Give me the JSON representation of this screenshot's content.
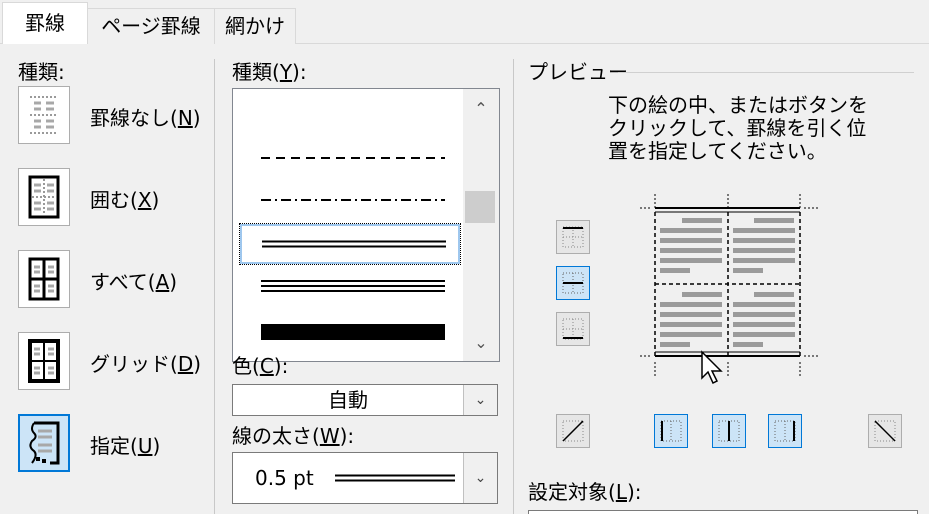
{
  "tabs": [
    {
      "label": "罫線",
      "active": true
    },
    {
      "label": "ページ罫線",
      "active": false
    },
    {
      "label": "網かけ",
      "active": false
    }
  ],
  "setting": {
    "heading": "種類:",
    "options": [
      {
        "label_text": "罫線なし(",
        "key": "N",
        "label_end": ")",
        "icon": "no-border-icon",
        "selected": false
      },
      {
        "label_text": "囲む(",
        "key": "X",
        "label_end": ")",
        "icon": "box-border-icon",
        "selected": false
      },
      {
        "label_text": "すべて(",
        "key": "A",
        "label_end": ")",
        "icon": "all-borders-icon",
        "selected": false
      },
      {
        "label_text": "グリッド(",
        "key": "D",
        "label_end": ")",
        "icon": "grid-border-icon",
        "selected": false
      },
      {
        "label_text": "指定(",
        "key": "U",
        "label_end": ")",
        "icon": "custom-border-icon",
        "selected": true
      }
    ]
  },
  "style": {
    "label_text": "種類(",
    "key": "Y",
    "label_end": "):",
    "line_styles": [
      "dash",
      "dash-dot",
      "double",
      "thin-thick-thin",
      "thick"
    ],
    "selected_index": 2
  },
  "color": {
    "label_text": "色(",
    "key": "C",
    "label_end": "):",
    "value": "自動"
  },
  "width": {
    "label_text": "線の太さ(",
    "key": "W",
    "label_end": "):",
    "value": "0.5 pt"
  },
  "preview": {
    "heading": "プレビュー",
    "instructions": [
      "下の絵の中、またはボタンを",
      "クリックして、罫線を引く位",
      "置を指定してください。"
    ]
  },
  "apply_to": {
    "label_text": "設定対象(",
    "key": "L",
    "label_end": "):"
  },
  "colors": {
    "accent": "#0078d7",
    "selected_bg": "#cce4f7",
    "dialog_bg": "#f0f0f0"
  }
}
